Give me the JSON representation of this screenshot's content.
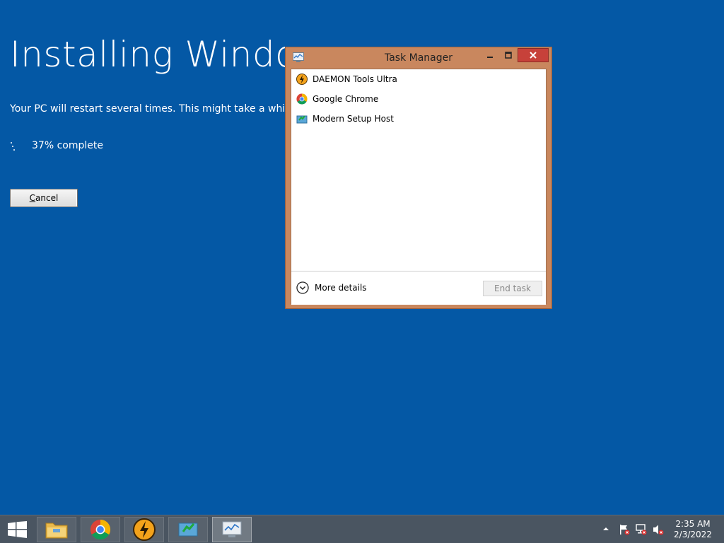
{
  "setup": {
    "title": "Installing Window",
    "subtitle": "Your PC will restart several times. This might take a while.",
    "progress_text": "37% complete",
    "progress_value_percent": 37,
    "cancel_label": "Cancel",
    "cancel_accel": "C",
    "cancel_rest": "ancel"
  },
  "task_manager": {
    "title": "Task Manager",
    "processes": [
      {
        "name": "DAEMON Tools Ultra",
        "icon": "daemon-tools-icon"
      },
      {
        "name": "Google Chrome",
        "icon": "chrome-icon"
      },
      {
        "name": "Modern Setup Host",
        "icon": "setup-host-icon"
      }
    ],
    "more_details_label": "More details",
    "end_task_label": "End task",
    "colors": {
      "frame": "#c9875e",
      "close": "#c7413a"
    }
  },
  "taskbar": {
    "apps": [
      {
        "name": "file-explorer",
        "icon": "folder-icon"
      },
      {
        "name": "google-chrome",
        "icon": "chrome-icon"
      },
      {
        "name": "daemon-tools",
        "icon": "daemon-tools-icon"
      },
      {
        "name": "setup",
        "icon": "setup-icon"
      },
      {
        "name": "task-manager",
        "icon": "task-manager-icon",
        "active": true
      }
    ],
    "clock_time": "2:35 AM",
    "clock_date": "2/3/2022"
  },
  "colors": {
    "desktop": "#0458a5",
    "taskbar": "#4a5561"
  }
}
